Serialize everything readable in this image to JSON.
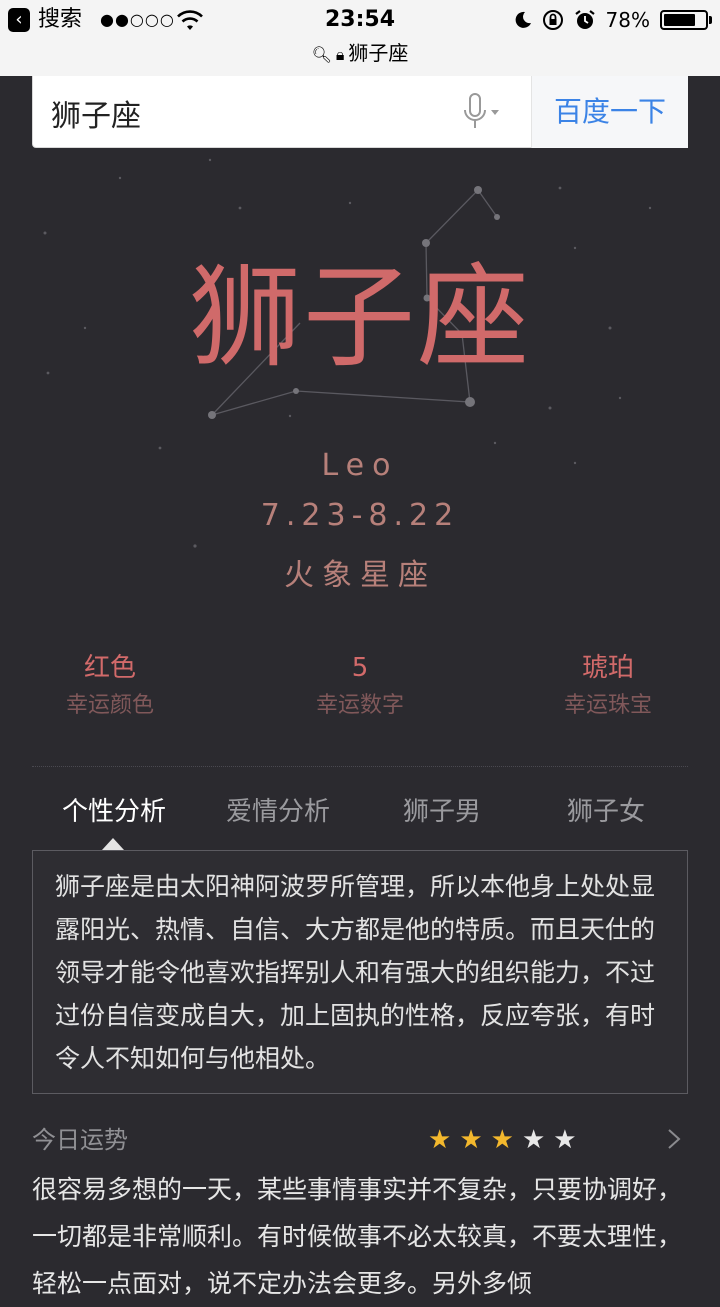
{
  "status_bar": {
    "back_label": "搜索",
    "signal": "●●○○○",
    "time": "23:54",
    "battery_text": "78%",
    "battery_level": 0.78,
    "url_title": "狮子座"
  },
  "search": {
    "query": "狮子座",
    "button_label": "百度一下"
  },
  "sign": {
    "title": "狮子座",
    "english": "Leo",
    "dates": "7.23-8.22",
    "element": "火象星座"
  },
  "lucky": [
    {
      "value": "红色",
      "label": "幸运颜色"
    },
    {
      "value": "5",
      "label": "幸运数字"
    },
    {
      "value": "琥珀",
      "label": "幸运珠宝"
    }
  ],
  "tabs": [
    {
      "label": "个性分析",
      "active": true
    },
    {
      "label": "爱情分析",
      "active": false
    },
    {
      "label": "狮子男",
      "active": false
    },
    {
      "label": "狮子女",
      "active": false
    }
  ],
  "personality_text": "狮子座是由太阳神阿波罗所管理，所以本他身上处处显露阳光、热情、自信、大方都是他的特质。而且天仕的领导才能令他喜欢指挥别人和有强大的组织能力，不过过份自信变成自大，加上固执的性格，反应夸张，有时令人不知如何与他相处。",
  "fortune": {
    "title": "今日运势",
    "stars_filled": 3,
    "stars_total": 5,
    "text": "很容易多想的一天，某些事情事实并不复杂，只要协调好，一切都是非常顺利。有时候做事不必太较真，不要太理性，轻松一点面对，说不定办法会更多。另外多倾"
  },
  "colors": {
    "accent": "#d06a6a",
    "background": "#2b2a2f",
    "link_blue": "#3b83e6",
    "star_gold": "#f3b82d"
  }
}
